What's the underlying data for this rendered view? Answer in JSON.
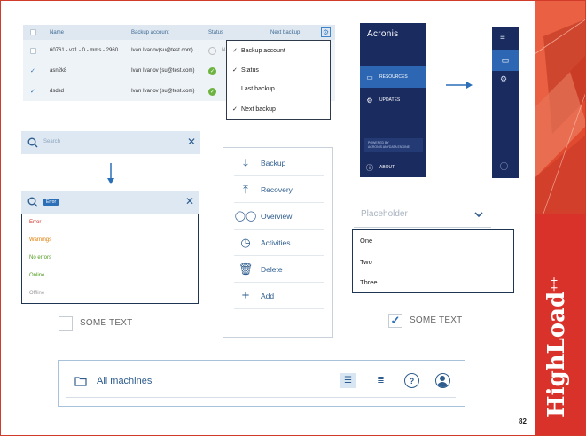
{
  "table": {
    "headers": {
      "name": "Name",
      "backup_account": "Backup account",
      "status": "Status",
      "next_backup": "Next backup"
    },
    "rows": [
      {
        "name": "60761 - vz1 - 0 - mms - 2960",
        "account": "Ivan Ivanov(su@test.com)",
        "status_letter": "N",
        "checked": false
      },
      {
        "name": "asn2k8",
        "account": "Ivan Ivanov (su@test.com)",
        "checked": true
      },
      {
        "name": "dsdsd",
        "account": "Ivan Ivanov (su@test.com)",
        "checked": true
      }
    ],
    "row_checked_glyph": "✓",
    "ok_glyph": "✓"
  },
  "column_menu": {
    "items": [
      {
        "label": "Backup account",
        "checked": true
      },
      {
        "label": "Status",
        "checked": true
      },
      {
        "label": "Last backup",
        "checked": false
      },
      {
        "label": "Next backup",
        "checked": true
      }
    ],
    "check_glyph": "✓"
  },
  "sidebar": {
    "logo": "Acronis",
    "items": [
      {
        "label": "RESOURCES",
        "icon": "monitor-icon"
      },
      {
        "label": "UPDATES",
        "icon": "gear-icon"
      }
    ],
    "powered_line1": "POWERED BY",
    "powered_line2": "ACRONIS ANYDATA ENGINE",
    "about": "ABOUT"
  },
  "search": {
    "placeholder": "Search",
    "chip": "Error",
    "results": [
      {
        "label": "Error",
        "color": "#d0342c"
      },
      {
        "label": "Warnings",
        "color": "#e07b00"
      },
      {
        "label": "No errors",
        "color": "#4d9a1c"
      },
      {
        "label": "Online",
        "color": "#4d9a1c"
      },
      {
        "label": "Offline",
        "color": "#9a9a9a"
      }
    ]
  },
  "actions": [
    {
      "label": "Backup",
      "icon": "backup-icon"
    },
    {
      "label": "Recovery",
      "icon": "recovery-icon"
    },
    {
      "label": "Overview",
      "icon": "glasses-icon"
    },
    {
      "label": "Activities",
      "icon": "clock-icon"
    },
    {
      "label": "Delete",
      "icon": "trash-icon"
    },
    {
      "label": "Add",
      "icon": "plus-icon"
    }
  ],
  "select": {
    "placeholder": "Placeholder",
    "options": [
      "One",
      "Two",
      "Three"
    ]
  },
  "checkboxes": {
    "unchecked_label": "SOME TEXT",
    "checked_label": "SOME TEXT",
    "check_glyph": "✓"
  },
  "bottom_bar": {
    "title": "All machines"
  },
  "brand": {
    "name": "HighLoad",
    "plus": "++"
  },
  "page_number": "82",
  "colors": {
    "accent": "#2a6fb8",
    "sidebar": "#1a2b5f",
    "sidebar_active": "#2d67b4",
    "brand_red": "#d23a2a"
  }
}
